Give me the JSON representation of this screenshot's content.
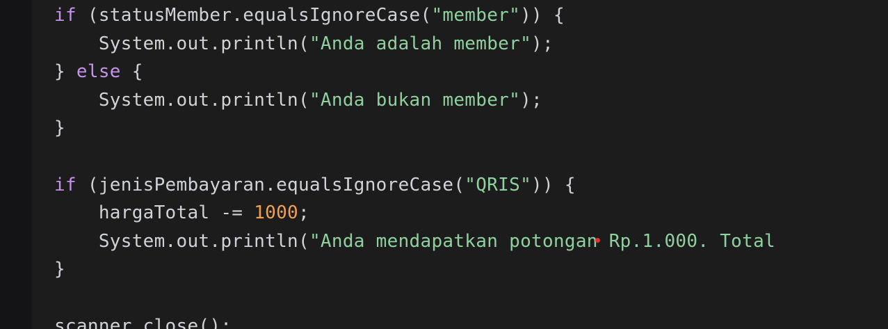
{
  "colors": {
    "background": "#1c1c1d",
    "gutter": "#141416",
    "keyword": "#c792ea",
    "string": "#8fd19e",
    "number": "#f0a050",
    "text": "#cfd3d8",
    "cursor_dot": "#e0322e"
  },
  "code_lines": [
    {
      "indent": "",
      "tokens": [
        {
          "t": "kw",
          "v": "if"
        },
        {
          "t": "txt",
          "v": " (statusMember.equalsIgnoreCase("
        },
        {
          "t": "str",
          "v": "\"member\""
        },
        {
          "t": "txt",
          "v": ")) {"
        }
      ]
    },
    {
      "indent": "    ",
      "tokens": [
        {
          "t": "txt",
          "v": "System.out.println("
        },
        {
          "t": "str",
          "v": "\"Anda adalah member\""
        },
        {
          "t": "txt",
          "v": ");"
        }
      ]
    },
    {
      "indent": "",
      "tokens": [
        {
          "t": "txt",
          "v": "} "
        },
        {
          "t": "kw",
          "v": "else"
        },
        {
          "t": "txt",
          "v": " {"
        }
      ]
    },
    {
      "indent": "    ",
      "tokens": [
        {
          "t": "txt",
          "v": "System.out.println("
        },
        {
          "t": "str",
          "v": "\"Anda bukan member\""
        },
        {
          "t": "txt",
          "v": ");"
        }
      ]
    },
    {
      "indent": "",
      "tokens": [
        {
          "t": "txt",
          "v": "}"
        }
      ]
    },
    {
      "indent": "",
      "tokens": []
    },
    {
      "indent": "",
      "tokens": [
        {
          "t": "kw",
          "v": "if"
        },
        {
          "t": "txt",
          "v": " (jenisPembayaran.equalsIgnoreCase("
        },
        {
          "t": "str",
          "v": "\"QRIS\""
        },
        {
          "t": "txt",
          "v": ")) {"
        }
      ]
    },
    {
      "indent": "    ",
      "tokens": [
        {
          "t": "txt",
          "v": "hargaTotal -= "
        },
        {
          "t": "num",
          "v": "1000"
        },
        {
          "t": "txt",
          "v": ";"
        }
      ]
    },
    {
      "indent": "    ",
      "tokens": [
        {
          "t": "txt",
          "v": "System.out.println("
        },
        {
          "t": "str",
          "v": "\"Anda mendapatkan potongan Rp.1.000. Total"
        }
      ]
    },
    {
      "indent": "",
      "tokens": [
        {
          "t": "txt",
          "v": "}"
        }
      ]
    },
    {
      "indent": "",
      "tokens": []
    },
    {
      "indent": "",
      "tokens": [
        {
          "t": "txt",
          "v": "scanner.close();"
        }
      ]
    }
  ]
}
